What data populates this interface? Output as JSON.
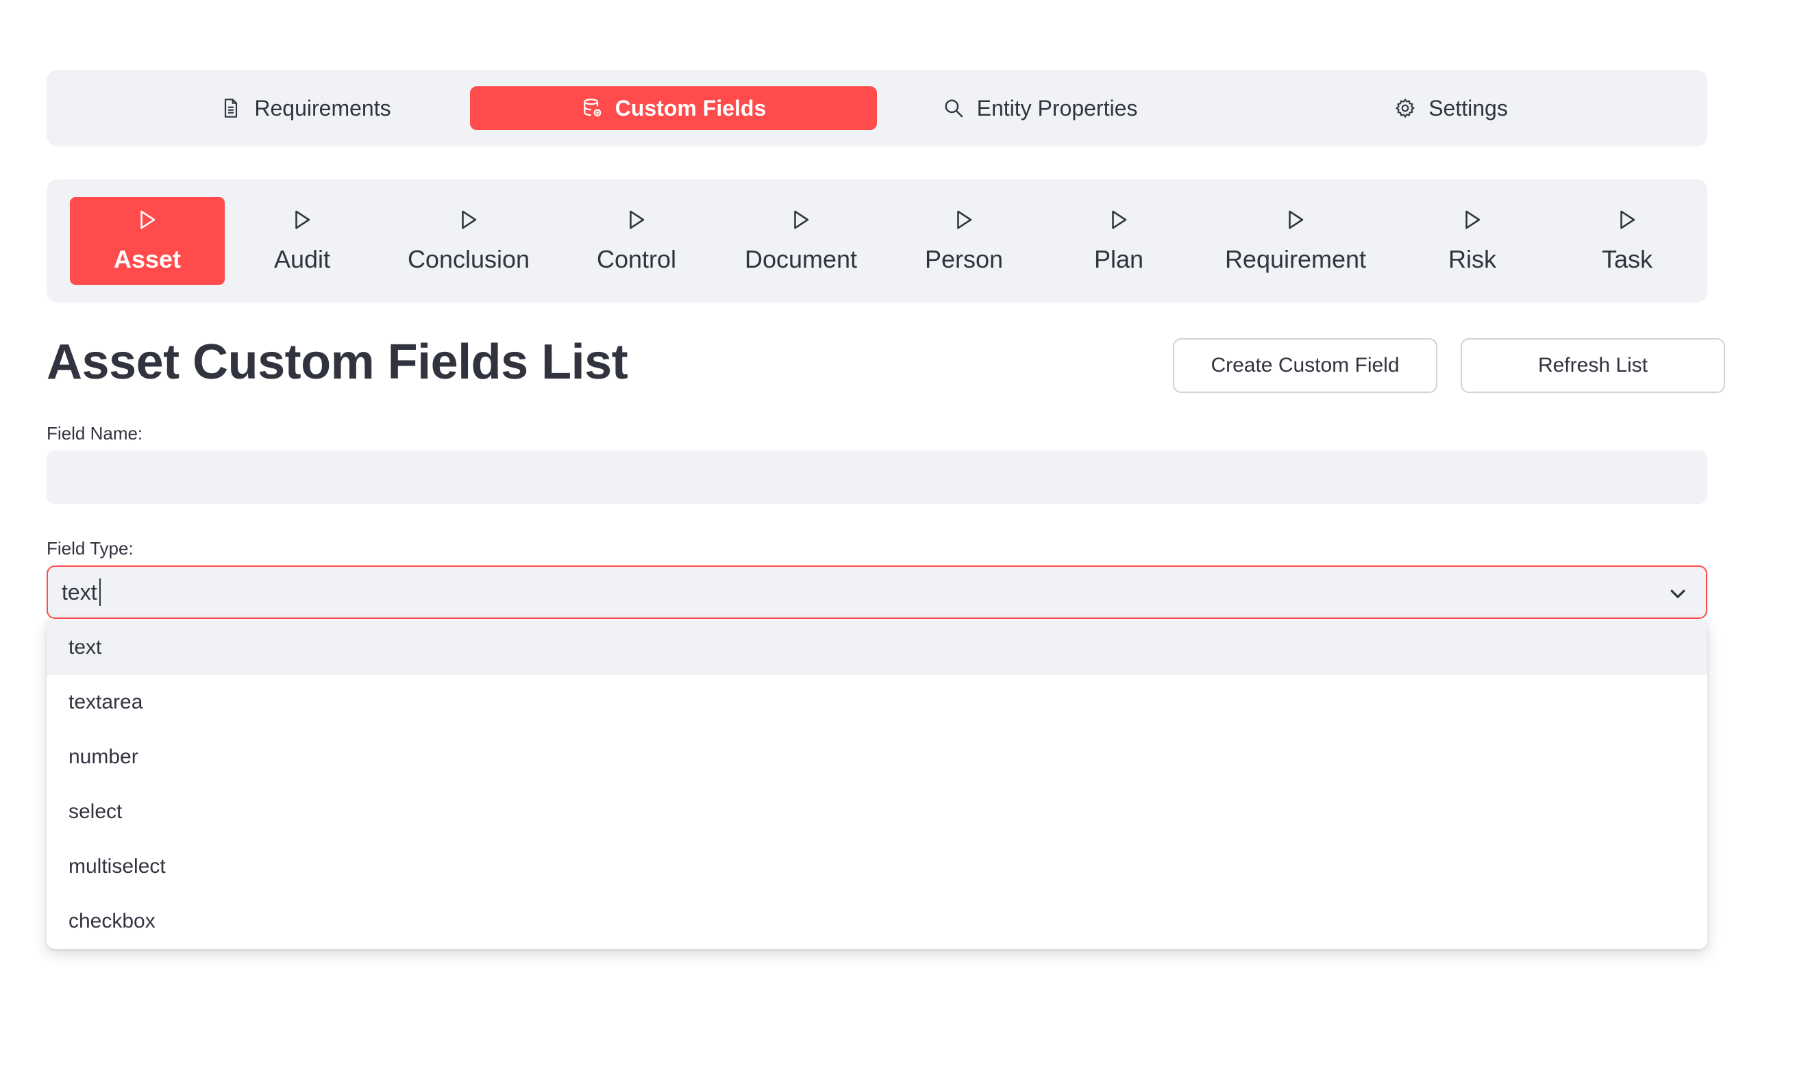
{
  "top_nav": {
    "items": [
      {
        "label": "Requirements",
        "icon": "document-icon"
      },
      {
        "label": "Custom Fields",
        "icon": "database-icon"
      },
      {
        "label": "Entity Properties",
        "icon": "search-icon"
      },
      {
        "label": "Settings",
        "icon": "gear-icon"
      }
    ],
    "active": "Custom Fields"
  },
  "entity_nav": {
    "items": [
      "Asset",
      "Audit",
      "Conclusion",
      "Control",
      "Document",
      "Person",
      "Plan",
      "Requirement",
      "Risk",
      "Task"
    ],
    "active": "Asset",
    "icon": "play-outline-icon"
  },
  "page": {
    "title": "Asset Custom Fields List",
    "create_button": "Create Custom Field",
    "refresh_button": "Refresh List"
  },
  "form": {
    "field_name_label": "Field Name:",
    "field_name_value": "",
    "field_type_label": "Field Type:",
    "field_type_value": "text",
    "field_type_options": [
      "text",
      "textarea",
      "number",
      "select",
      "multiselect",
      "checkbox"
    ],
    "highlighted_option": "text"
  },
  "colors": {
    "accent": "#ff4b4b",
    "nav_background": "#f0f2f6",
    "text": "#31333f"
  }
}
